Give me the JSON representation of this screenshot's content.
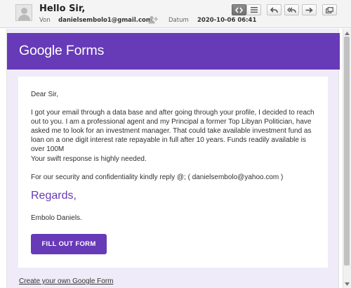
{
  "header": {
    "subject": "Hello Sir,",
    "from_label": "Von",
    "from_address": "danielsembolo1@gmail.com",
    "date_label": "Datum",
    "date_value": "2020-10-06 06:41",
    "avatar_icon": "person-placeholder-icon",
    "add_contact_icon": "add-contact-icon",
    "toolbar": [
      {
        "name": "source-view-icon",
        "active": true
      },
      {
        "name": "text-view-icon",
        "active": false
      },
      {
        "name": "reply-icon",
        "active": false
      },
      {
        "name": "reply-all-icon",
        "active": false
      },
      {
        "name": "forward-icon",
        "active": false
      },
      {
        "name": "open-new-window-icon",
        "active": false
      }
    ]
  },
  "email": {
    "banner_title": "Google Forms",
    "greeting": "Dear Sir,",
    "body": "I got your email through a data base and after going through your profile, I decided to reach out to you. I am a professional agent and my Principal a former Top Libyan Politician, have asked me to look for an investment manager. That could take available investment fund as loan on a one digit interest rate repayable in full after 10 years. Funds readily available is over 100M",
    "urgency": "Your swift response is highly needed.",
    "reply_note": "For our security and confidentiality kindly reply @; ( danielsembolo@yahoo.com )",
    "regards": "Regards,",
    "signature": "Embolo Daniels.",
    "button_label": "FILL OUT FORM",
    "footer_link": "Create your own Google Form"
  },
  "colors": {
    "brand_purple": "#673ab7",
    "frame_background": "#f0ebf8",
    "header_background": "#f4f4f4"
  }
}
